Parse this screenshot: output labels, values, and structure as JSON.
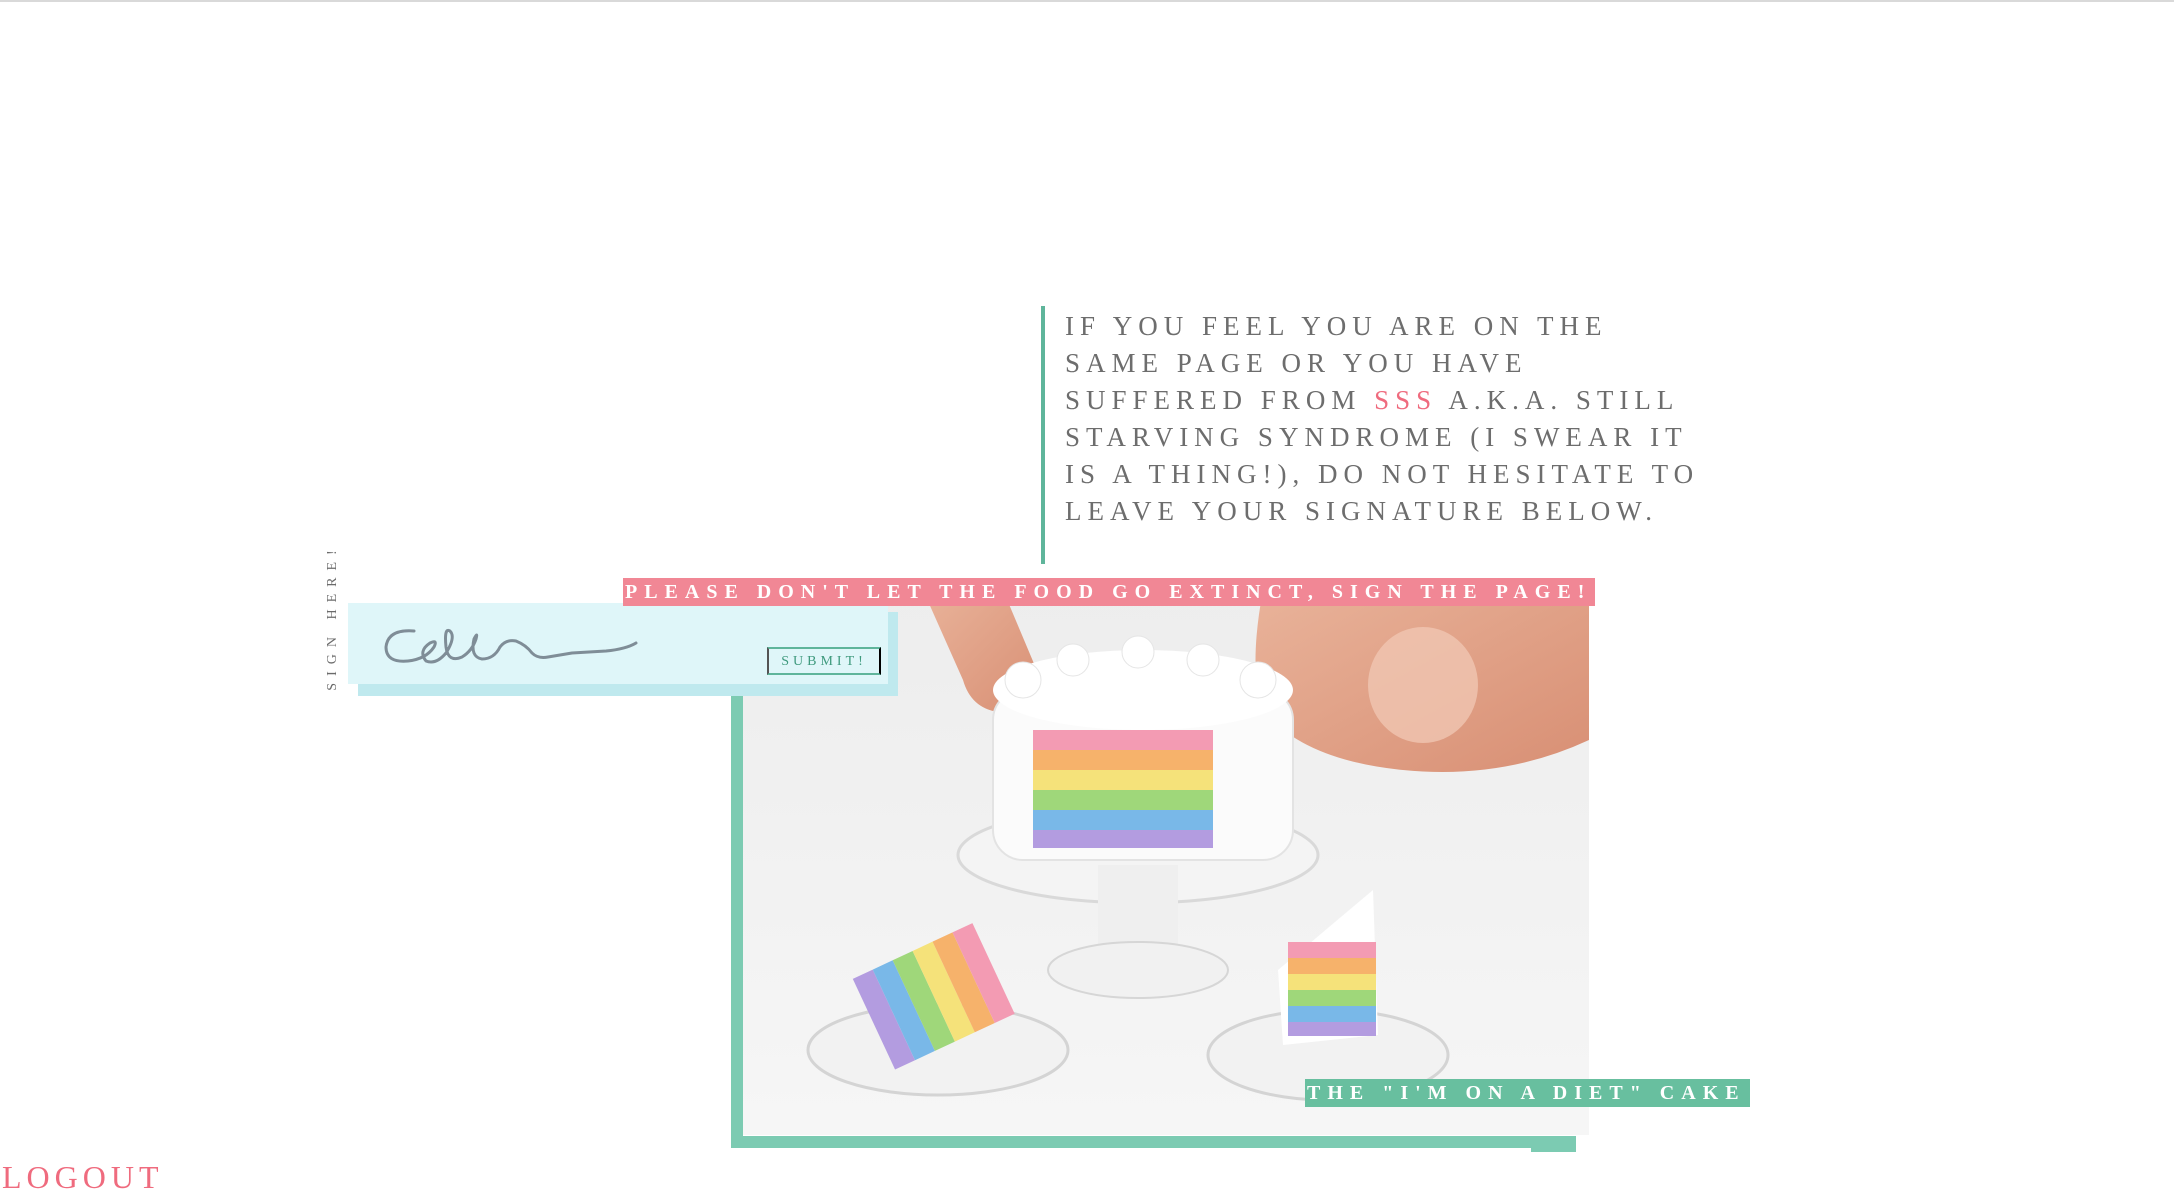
{
  "intro": {
    "text_before": "If you feel you are on the same page or you have suffered from ",
    "highlight": "SSS",
    "text_after": " a.k.a. still starving syndrome (I swear it is a thing!), do not hesitate to leave your signature below."
  },
  "form": {
    "sign_label": "Sign here!",
    "banner": "Please don't let the food go extinct, sign the page!",
    "submit_label": "Submit!"
  },
  "image": {
    "caption": "The \"I'm on a diet\" cake"
  },
  "nav": {
    "logout_label": "Logout"
  },
  "colors": {
    "accent_pink": "#ef6b7e",
    "banner_pink": "#f18795",
    "accent_green": "#5fb59b",
    "frame_green": "#7ccbb2",
    "signature_bg": "#dff6f9"
  }
}
